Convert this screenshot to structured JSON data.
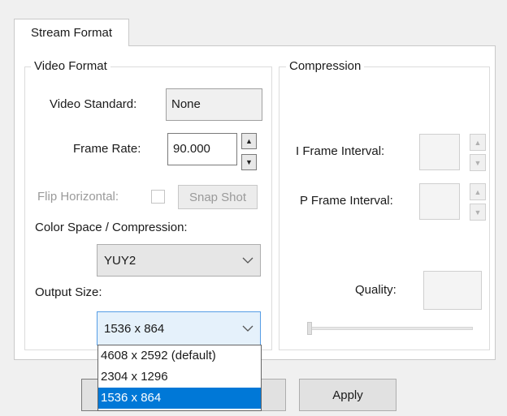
{
  "tab": {
    "label": "Stream Format"
  },
  "video_format": {
    "legend": "Video Format",
    "video_standard": {
      "label": "Video Standard:",
      "value": "None"
    },
    "frame_rate": {
      "label": "Frame Rate:",
      "value": "90.000"
    },
    "flip_horizontal": {
      "label": "Flip Horizontal:",
      "checked": false
    },
    "snap_shot": {
      "label": "Snap Shot"
    },
    "color_space": {
      "label": "Color Space / Compression:",
      "value": "YUY2"
    },
    "output_size": {
      "label": "Output Size:",
      "value": "1536 x 864",
      "options": [
        "4608 x 2592  (default)",
        "2304 x 1296",
        "1536 x 864"
      ],
      "selected_index": 2
    }
  },
  "compression": {
    "legend": "Compression",
    "i_frame": {
      "label": "I Frame Interval:",
      "value": ""
    },
    "p_frame": {
      "label": "P Frame Interval:",
      "value": ""
    },
    "quality": {
      "label": "Quality:",
      "value": ""
    }
  },
  "buttons": {
    "apply": "Apply"
  },
  "colors": {
    "selection": "#0078d7",
    "focus_border": "#569de5"
  },
  "icons": {
    "spin_up": "triangle-up-icon",
    "spin_down": "triangle-down-icon",
    "dropdown": "chevron-down-icon"
  }
}
